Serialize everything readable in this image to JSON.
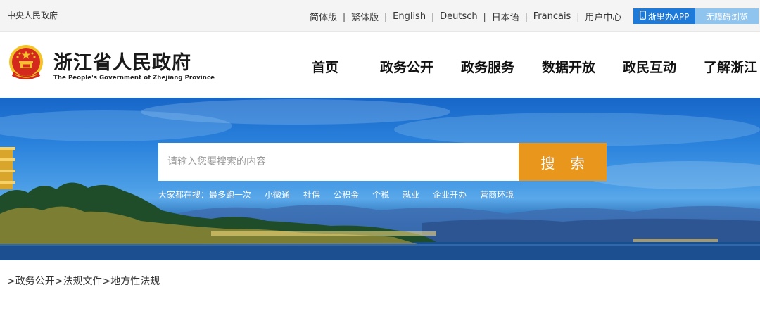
{
  "topbar": {
    "central_link": "中央人民政府",
    "languages": [
      "简体版",
      "繁体版",
      "English",
      "Deutsch",
      "日本语",
      "Francais",
      "用户中心"
    ],
    "app_button": "浙里办APP",
    "accessibility_button": "无障碍浏览"
  },
  "header": {
    "title": "浙江省人民政府",
    "subtitle": "The People's Government of Zhejiang Province",
    "nav": [
      "首页",
      "政务公开",
      "政务服务",
      "数据开放",
      "政民互动",
      "了解浙江"
    ]
  },
  "search": {
    "placeholder": "请输入您要搜索的内容",
    "button": "搜 索",
    "hot_label": "大家都在搜：",
    "hot_keywords": [
      "最多跑一次",
      "小微通",
      "社保",
      "公积金",
      "个税",
      "就业",
      "企业开办",
      "营商环境"
    ]
  },
  "breadcrumb": [
    ">政务公开",
    ">法规文件",
    ">地方性法规"
  ],
  "colors": {
    "accent_blue": "#1e7ad8",
    "search_button": "#e9961c",
    "emblem_red": "#d42a1d",
    "emblem_gold": "#f3c32a"
  },
  "icons": {
    "app_button": "phone-icon",
    "emblem": "national-emblem-icon"
  }
}
